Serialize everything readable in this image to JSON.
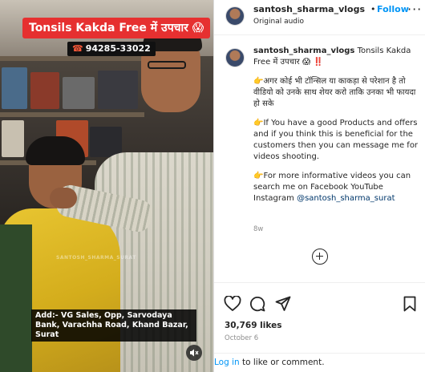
{
  "video": {
    "title_banner": "Tonsils Kakda Free में उपचार 😱",
    "phone_icon": "phone-icon",
    "phone": "94285-33022",
    "watermark": "SANTOSH_SHARMA_SURAT",
    "address": "Add:- VG Sales, Opp, Sarvodaya Bank, Varachha Road, Khand Bazar, Surat",
    "sound_icon": "speaker-muted-icon"
  },
  "header": {
    "username": "santosh_sharma_vlogs",
    "separator": "•",
    "follow_label": "Follow",
    "audio_label": "Original audio",
    "more_icon": "more-options-icon",
    "more_label": "···"
  },
  "caption": {
    "username": "santosh_sharma_vlogs",
    "title": "Tonsils Kakda Free में उपचार 😱 ‼️",
    "paragraph_1": "👉अगर कोई भी टॉन्सिल या काकड़ा से परेशान है तो वीडियो को उनके साथ शेयर करो ताकि उनका भी फायदा हो सके",
    "paragraph_2": "👉If You have a good Products and offers and if you think this is beneficial for the customers then you can message me for videos shooting.",
    "paragraph_3": "👉For more informative videos you can search me on Facebook YouTube Instagram",
    "mention": "@santosh_sharma_surat",
    "time_ago": "8w"
  },
  "comments": {
    "load_more_icon": "plus-circle-icon"
  },
  "actions": {
    "like_icon": "heart-icon",
    "comment_icon": "comment-icon",
    "share_icon": "share-icon",
    "save_icon": "bookmark-icon",
    "likes": "30,769 likes",
    "date": "October 6"
  },
  "footer": {
    "login_link": "Log in",
    "rest": " to like or comment."
  },
  "colors": {
    "follow": "#0095f6",
    "banner": "#e63030",
    "text": "#262626",
    "muted": "#8e8e8e"
  }
}
